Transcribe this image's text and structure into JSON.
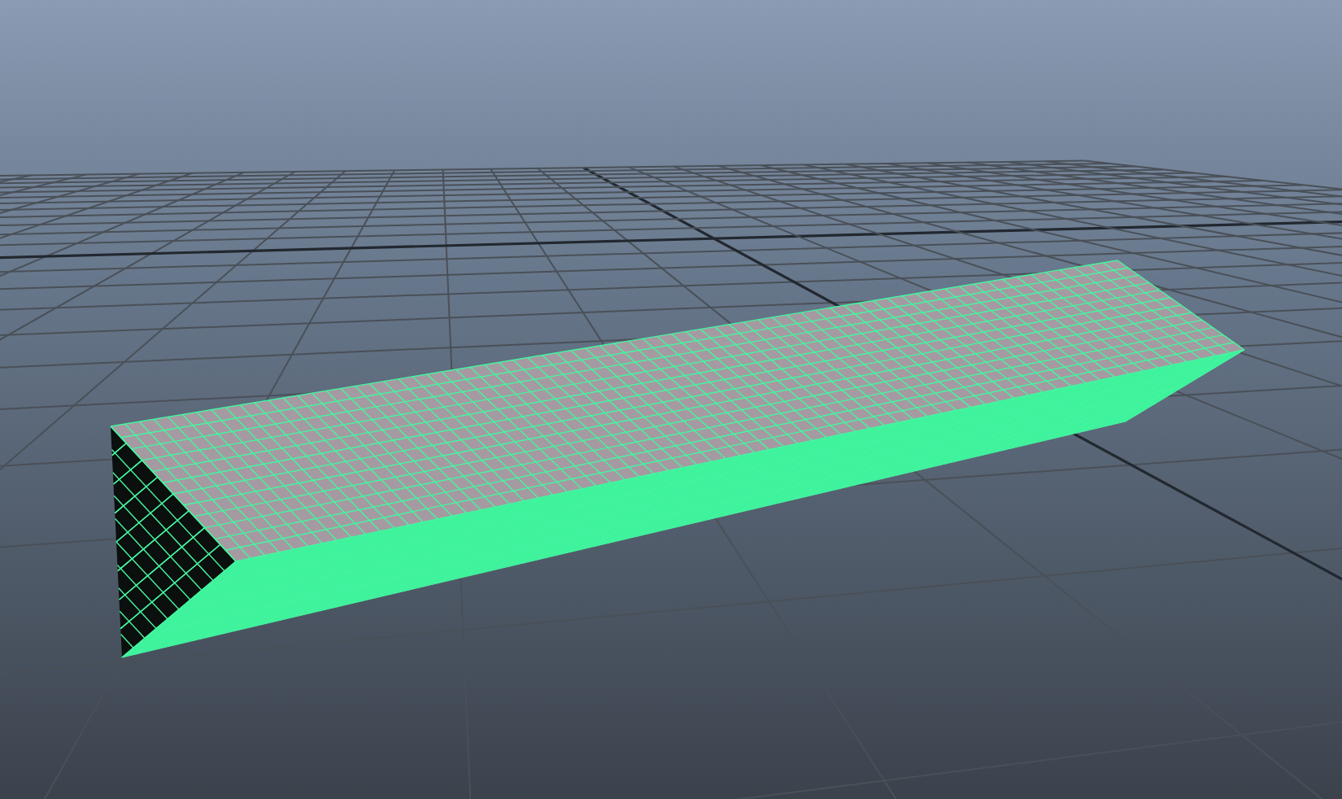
{
  "viewport": {
    "grid_visible": true,
    "mesh": {
      "selected": true
    }
  }
}
